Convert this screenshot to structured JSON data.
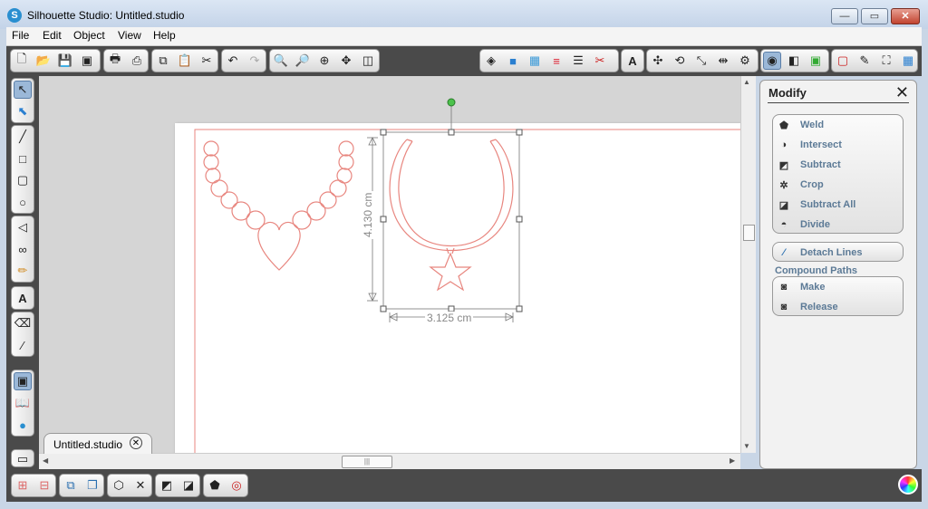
{
  "window": {
    "title": "Silhouette Studio: Untitled.studio",
    "minimize": "—",
    "maximize": "▭",
    "close": "✕"
  },
  "menu": [
    "File",
    "Edit",
    "Object",
    "View",
    "Help"
  ],
  "document": {
    "tab_label": "Untitled.studio",
    "height_label": "4.130 cm",
    "width_label": "3.125 cm"
  },
  "modify_panel": {
    "title": "Modify",
    "close": "✕",
    "group1": [
      {
        "label": "Weld",
        "icon": "weld-icon"
      },
      {
        "label": "Intersect",
        "icon": "intersect-icon"
      },
      {
        "label": "Subtract",
        "icon": "subtract-icon"
      },
      {
        "label": "Crop",
        "icon": "crop-icon"
      },
      {
        "label": "Subtract All",
        "icon": "subtract-all-icon"
      },
      {
        "label": "Divide",
        "icon": "divide-icon"
      }
    ],
    "detach": {
      "label": "Detach Lines",
      "icon": "detach-lines-icon"
    },
    "compound_title": "Compound Paths",
    "compound": [
      {
        "label": "Make",
        "icon": "make-compound-icon"
      },
      {
        "label": "Release",
        "icon": "release-compound-icon"
      }
    ]
  },
  "colors": {
    "cut_line": "#e8867f",
    "accent": "#5c7a96",
    "toolbar_bg": "#4a4a4a"
  }
}
